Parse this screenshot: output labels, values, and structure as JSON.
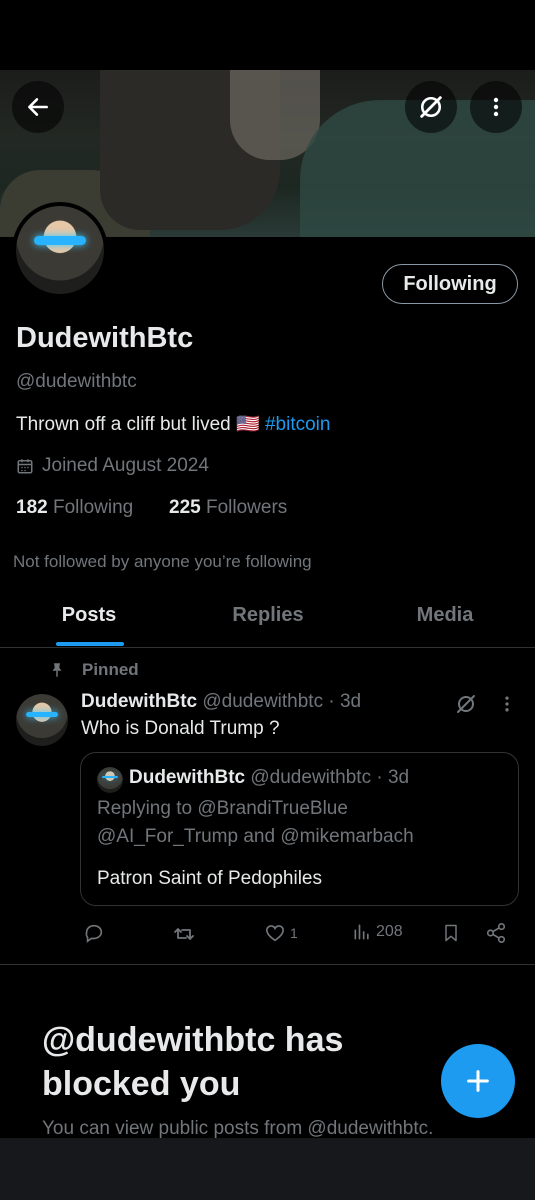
{
  "profile": {
    "display_name": "DudewithBtc",
    "handle": "@dudewithbtc",
    "bio_text": "Thrown off a cliff but lived 🇺🇸",
    "bio_hashtag": "#bitcoin",
    "joined": "Joined August 2024",
    "following_count": "182",
    "following_label": "Following",
    "followers_count": "225",
    "followers_label": "Followers",
    "not_followed_note": "Not followed by anyone you’re following",
    "follow_button_label": "Following"
  },
  "tabs": [
    {
      "label": "Posts",
      "active": true
    },
    {
      "label": "Replies",
      "active": false
    },
    {
      "label": "Media",
      "active": false
    }
  ],
  "post": {
    "pinned_label": "Pinned",
    "author": "DudewithBtc",
    "handle_time": "@dudewithbtc · 3d",
    "text": "Who is Donald Trump ?",
    "quote": {
      "author": "DudewithBtc",
      "handle_time": "@dudewithbtc · 3d",
      "replying_line1": "Replying to @BrandiTrueBlue",
      "replying_line2": "@AI_For_Trump and @mikemarbach",
      "text": "Patron Saint of Pedophiles"
    },
    "actions": {
      "likes": "1",
      "views": "208"
    }
  },
  "blocked": {
    "title_line1": "@dudewithbtc has",
    "title_line2": "blocked you",
    "subtitle": "You can view public posts from @dudewithbtc."
  },
  "icons": {
    "back": "arrow-left-icon",
    "grok": "grok-slash-icon",
    "more": "more-vertical-icon",
    "calendar": "calendar-icon",
    "pin": "pin-icon",
    "reply": "reply-icon",
    "repost": "repost-icon",
    "like": "heart-icon",
    "views": "views-icon",
    "bookmark": "bookmark-icon",
    "share": "share-icon",
    "compose": "plus-icon"
  },
  "colors": {
    "accent": "#1d9bf0",
    "background": "#000000",
    "text": "#e7e9ea",
    "muted": "#71767b"
  }
}
